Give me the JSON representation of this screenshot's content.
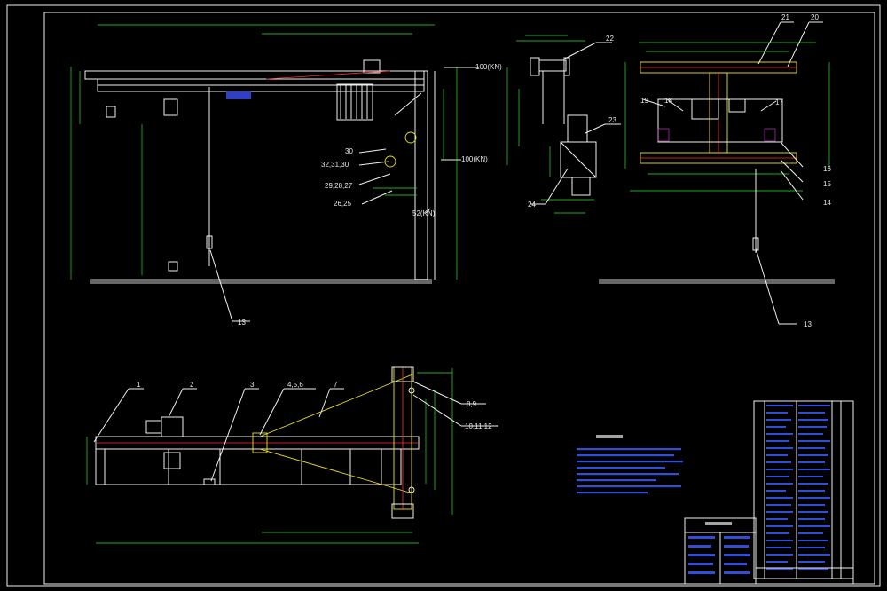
{
  "labels": {
    "load_top": "100(KN)",
    "load_mid": "100(KN)",
    "load_bottom": "52(KN)",
    "p30": "30",
    "p32_31_30": "32,31,30",
    "p29_28_27": "29,28,27",
    "p26_25": "26,25",
    "p13_left": "13",
    "p22": "22",
    "p23": "23",
    "p24": "24",
    "p21": "21",
    "p20": "20",
    "p19": "19",
    "p18": "18",
    "p17": "17",
    "p16": "16",
    "p15": "15",
    "p14": "14",
    "p13_right": "13",
    "p1": "1",
    "p2": "2",
    "p3": "3",
    "p4_5_6": "4,5,6",
    "p7": "7",
    "p8_9": "8,9",
    "p10_11_12": "10,11,12"
  },
  "colors": {
    "background": "#000000",
    "outline": "#f0f0f0",
    "dimension": "#2fe02f",
    "structure": "#f0e020",
    "centerline": "#ff3030",
    "title_block": "#6060ff"
  }
}
